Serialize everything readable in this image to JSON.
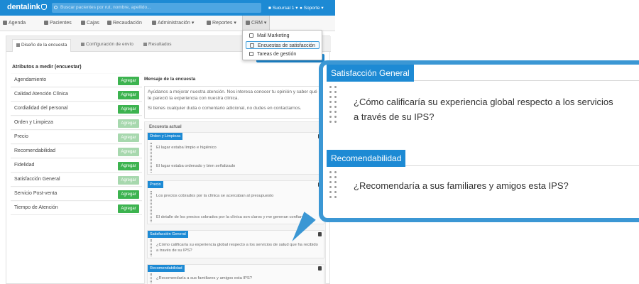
{
  "app": {
    "logo_text": "dentalink",
    "search_placeholder": "Buscar pacientes por rut, nombre, apellido...",
    "sucursal_label": "Sucursal 1",
    "user_label": "Soporte"
  },
  "nav": {
    "items": [
      {
        "label": "Agenda"
      },
      {
        "label": "Pacientes"
      },
      {
        "label": "Cajas"
      },
      {
        "label": "Recaudación"
      },
      {
        "label": "Administración ▾"
      },
      {
        "label": "Reportes ▾"
      },
      {
        "label": "CRM ▾"
      }
    ]
  },
  "crm_menu": {
    "items": [
      {
        "label": "Mail Marketing"
      },
      {
        "label": "Encuestas de satisfacción"
      },
      {
        "label": "Tareas de gestión"
      }
    ]
  },
  "subtabs": [
    {
      "label": "Diseño de la encuesta"
    },
    {
      "label": "Configuración de envío"
    },
    {
      "label": "Resultados"
    }
  ],
  "attributes": {
    "title": "Atributos a medir (encuestar)",
    "button_label": "Agregar",
    "items": [
      {
        "name": "Agendamiento"
      },
      {
        "name": "Calidad Atención Clínica"
      },
      {
        "name": "Cordialidad del personal"
      },
      {
        "name": "Orden y Limpieza"
      },
      {
        "name": "Precio"
      },
      {
        "name": "Recomendabilidad"
      },
      {
        "name": "Fidelidad"
      },
      {
        "name": "Satisfacción General"
      },
      {
        "name": "Servicio Post-venta"
      },
      {
        "name": "Tiempo de Atención"
      }
    ]
  },
  "message": {
    "title": "Mensaje de la encuesta",
    "line1": "Ayúdanos a mejorar nuestra atención. Nos interesa conocer tu opinión y saber qué",
    "line2": "te pareció la experiencia con nuestra clínica.",
    "line3": "Si tienes cualquier duda o comentario adicional, no dudes en contactarnos."
  },
  "survey": {
    "label": "Encuesta actual",
    "blocks": [
      {
        "tag": "Orden y Limpieza",
        "q1": "El lugar estaba limpio e higiénico",
        "q2": "El lugar estaba ordenado y bien señalizado"
      },
      {
        "tag": "Precio",
        "q1": "Los precios cobrados por la clínica se acercaban al presupuesto",
        "q2": "El detalle de los precios cobrados por la clínica son claros y me generan confianza"
      },
      {
        "tag": "Satisfacción General",
        "q1": "¿Cómo calificaría su experiencia global respecto a los servicios de salud que ha recibido a través de su IPS?"
      },
      {
        "tag": "Recomendabilidad",
        "q1": "¿Recomendaría a sus familiares y amigos esta IPS?"
      }
    ]
  },
  "callout": {
    "block1_tag": "Satisfacción General",
    "block1_q_line1": "¿Cómo calificaría su experiencia global respecto a los servicios",
    "block1_q_line2": "a través de su IPS?",
    "block2_tag": "Recomendabilidad",
    "block2_q": "¿Recomendaría a sus familiares y amigos esta IPS?"
  },
  "colors": {
    "brand": "#1d8ad4",
    "add_button": "#3cb34f",
    "callout_border": "#3b97d4"
  }
}
